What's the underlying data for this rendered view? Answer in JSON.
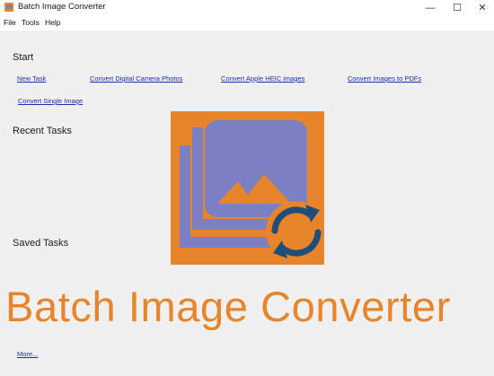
{
  "window": {
    "title": "Batch Image Converter",
    "controls": {
      "minimize": "—",
      "maximize": "☐",
      "close": "✕"
    }
  },
  "menu": [
    "File",
    "Tools",
    "Help"
  ],
  "start": {
    "heading": "Start",
    "links": [
      "New Task",
      "Convert Digital Camera Photos",
      "Convert Apple HEIC images",
      "Convert Images to PDFs",
      "Convert Single Image"
    ]
  },
  "recent": {
    "heading": "Recent Tasks"
  },
  "saved": {
    "heading": "Saved Tasks"
  },
  "hero": {
    "icon": "image-convert-icon",
    "colors": {
      "background": "#e8842a",
      "photo": "#7b7fc4",
      "arrows": "#1f4e79"
    }
  },
  "banner": {
    "title": "Batch Image Converter",
    "color": "#e8842a"
  },
  "footer": {
    "more_link": "More..."
  }
}
